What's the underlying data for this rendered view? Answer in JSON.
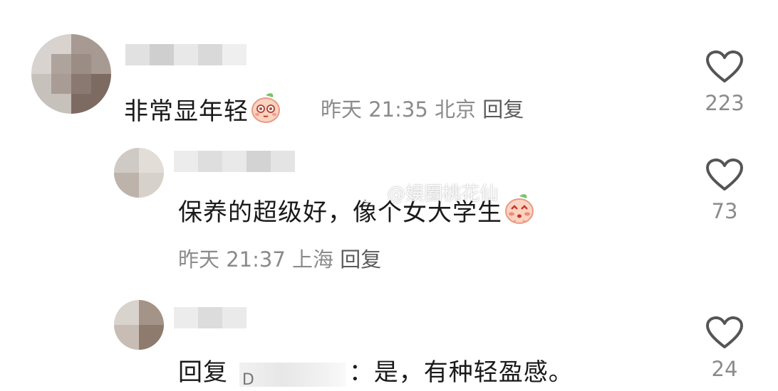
{
  "comments": [
    {
      "text": "非常显年轻",
      "time": "昨天 21:35",
      "location": "北京",
      "reply_label": "回复",
      "likes": "223",
      "emoji_icon": "peach-shy-emoji-icon"
    },
    {
      "text": "保养的超级好，像个女大学生",
      "time": "昨天 21:37",
      "location": "上海",
      "reply_label": "回复",
      "likes": "73",
      "emoji_icon": "peach-blush-emoji-icon"
    },
    {
      "reply_prefix": "回复",
      "mention_initial": "D",
      "text": "：是，有种轻盈感。",
      "likes": "24"
    }
  ],
  "watermark": "@娱圈桃花仙",
  "icons": {
    "like": "heart-outline-icon",
    "weibo": "weibo-logo-icon"
  },
  "colors": {
    "meta_gray": "#8b8b8b",
    "text": "#1a1a1a",
    "heart_stroke": "#555555"
  }
}
